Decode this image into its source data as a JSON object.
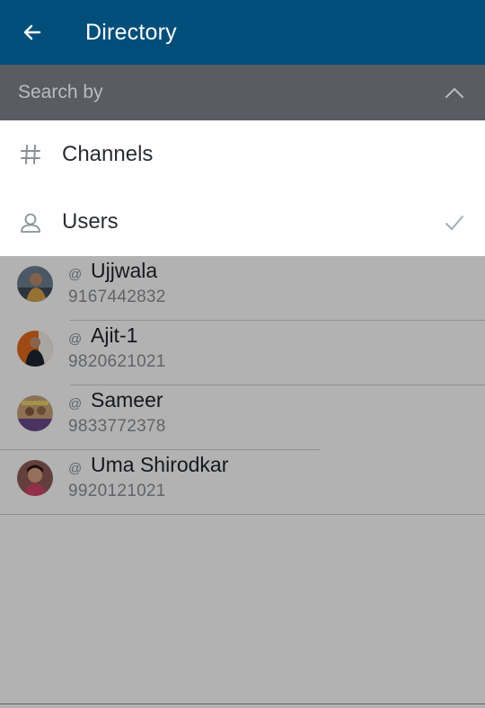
{
  "header": {
    "title": "Directory",
    "back_icon": "arrow-left-icon",
    "background": "#004e7a"
  },
  "search_by": {
    "label": "Search by",
    "collapse_icon": "chevron-up-icon",
    "options": [
      {
        "label": "Channels",
        "icon": "hash-icon",
        "selected": false
      },
      {
        "label": "Users",
        "icon": "user-icon",
        "selected": true
      }
    ]
  },
  "users": [
    {
      "prefix": "@",
      "name": "Ujjwala",
      "phone": "9167442832"
    },
    {
      "prefix": "@",
      "name": "Ajit-1",
      "phone": "9820621021"
    },
    {
      "prefix": "@",
      "name": "Sameer",
      "phone": "9833772378"
    },
    {
      "prefix": "@",
      "name": "Uma Shirodkar",
      "phone": "9920121021"
    }
  ]
}
